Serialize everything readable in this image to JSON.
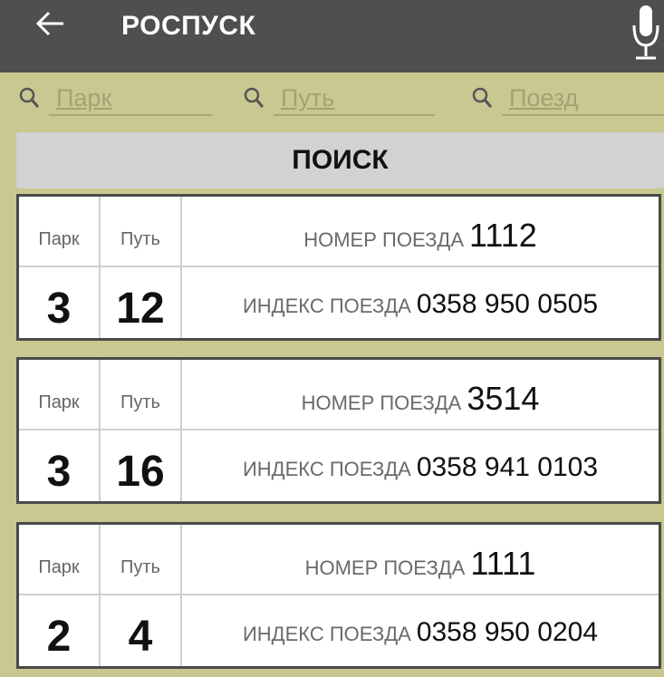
{
  "header": {
    "title": "РОСПУСК"
  },
  "filters": {
    "park_placeholder": "Парк",
    "track_placeholder": "Путь",
    "train_placeholder": "Поезд"
  },
  "search_label": "ПОИСК",
  "labels": {
    "park": "Парк",
    "track": "Путь",
    "train_number": "НОМЕР ПОЕЗДА",
    "train_index": "ИНДЕКС ПОЕЗДА"
  },
  "trains": [
    {
      "park": "3",
      "track": "12",
      "number": "1112",
      "index": "0358 950 0505"
    },
    {
      "park": "3",
      "track": "16",
      "number": "3514",
      "index": "0358 941 0103"
    },
    {
      "park": "2",
      "track": "4",
      "number": "1111",
      "index": "0358 950 0204"
    }
  ],
  "colors": {
    "background": "#c8c890",
    "topbar": "#4f4f4f",
    "search_button": "#d2d2d2"
  }
}
